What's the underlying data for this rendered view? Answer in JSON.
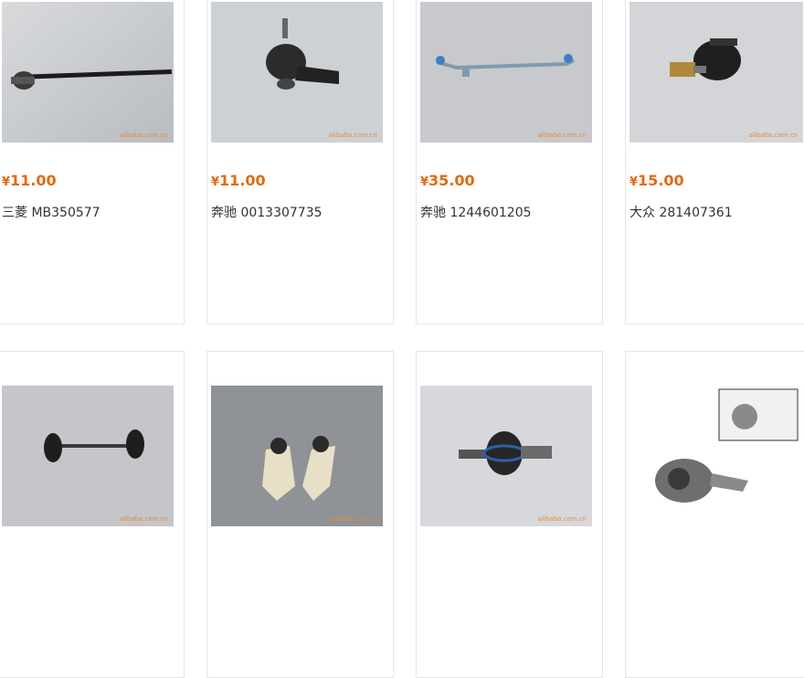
{
  "watermark": "alibaba.com.cn",
  "currency": "¥",
  "products": [
    {
      "price": "11.00",
      "title": "三菱 MB350577",
      "image": "tie-rod-inner"
    },
    {
      "price": "11.00",
      "title": "奔驰 0013307735",
      "image": "tie-rod-end"
    },
    {
      "price": "35.00",
      "title": "奔驰 1244601205",
      "image": "center-link"
    },
    {
      "price": "15.00",
      "title": "大众 281407361",
      "image": "ball-joint"
    },
    {
      "image": "stabilizer-link"
    },
    {
      "image": "ball-joint-pair"
    },
    {
      "image": "ball-joint-blue"
    },
    {
      "image": "water-pump"
    }
  ]
}
